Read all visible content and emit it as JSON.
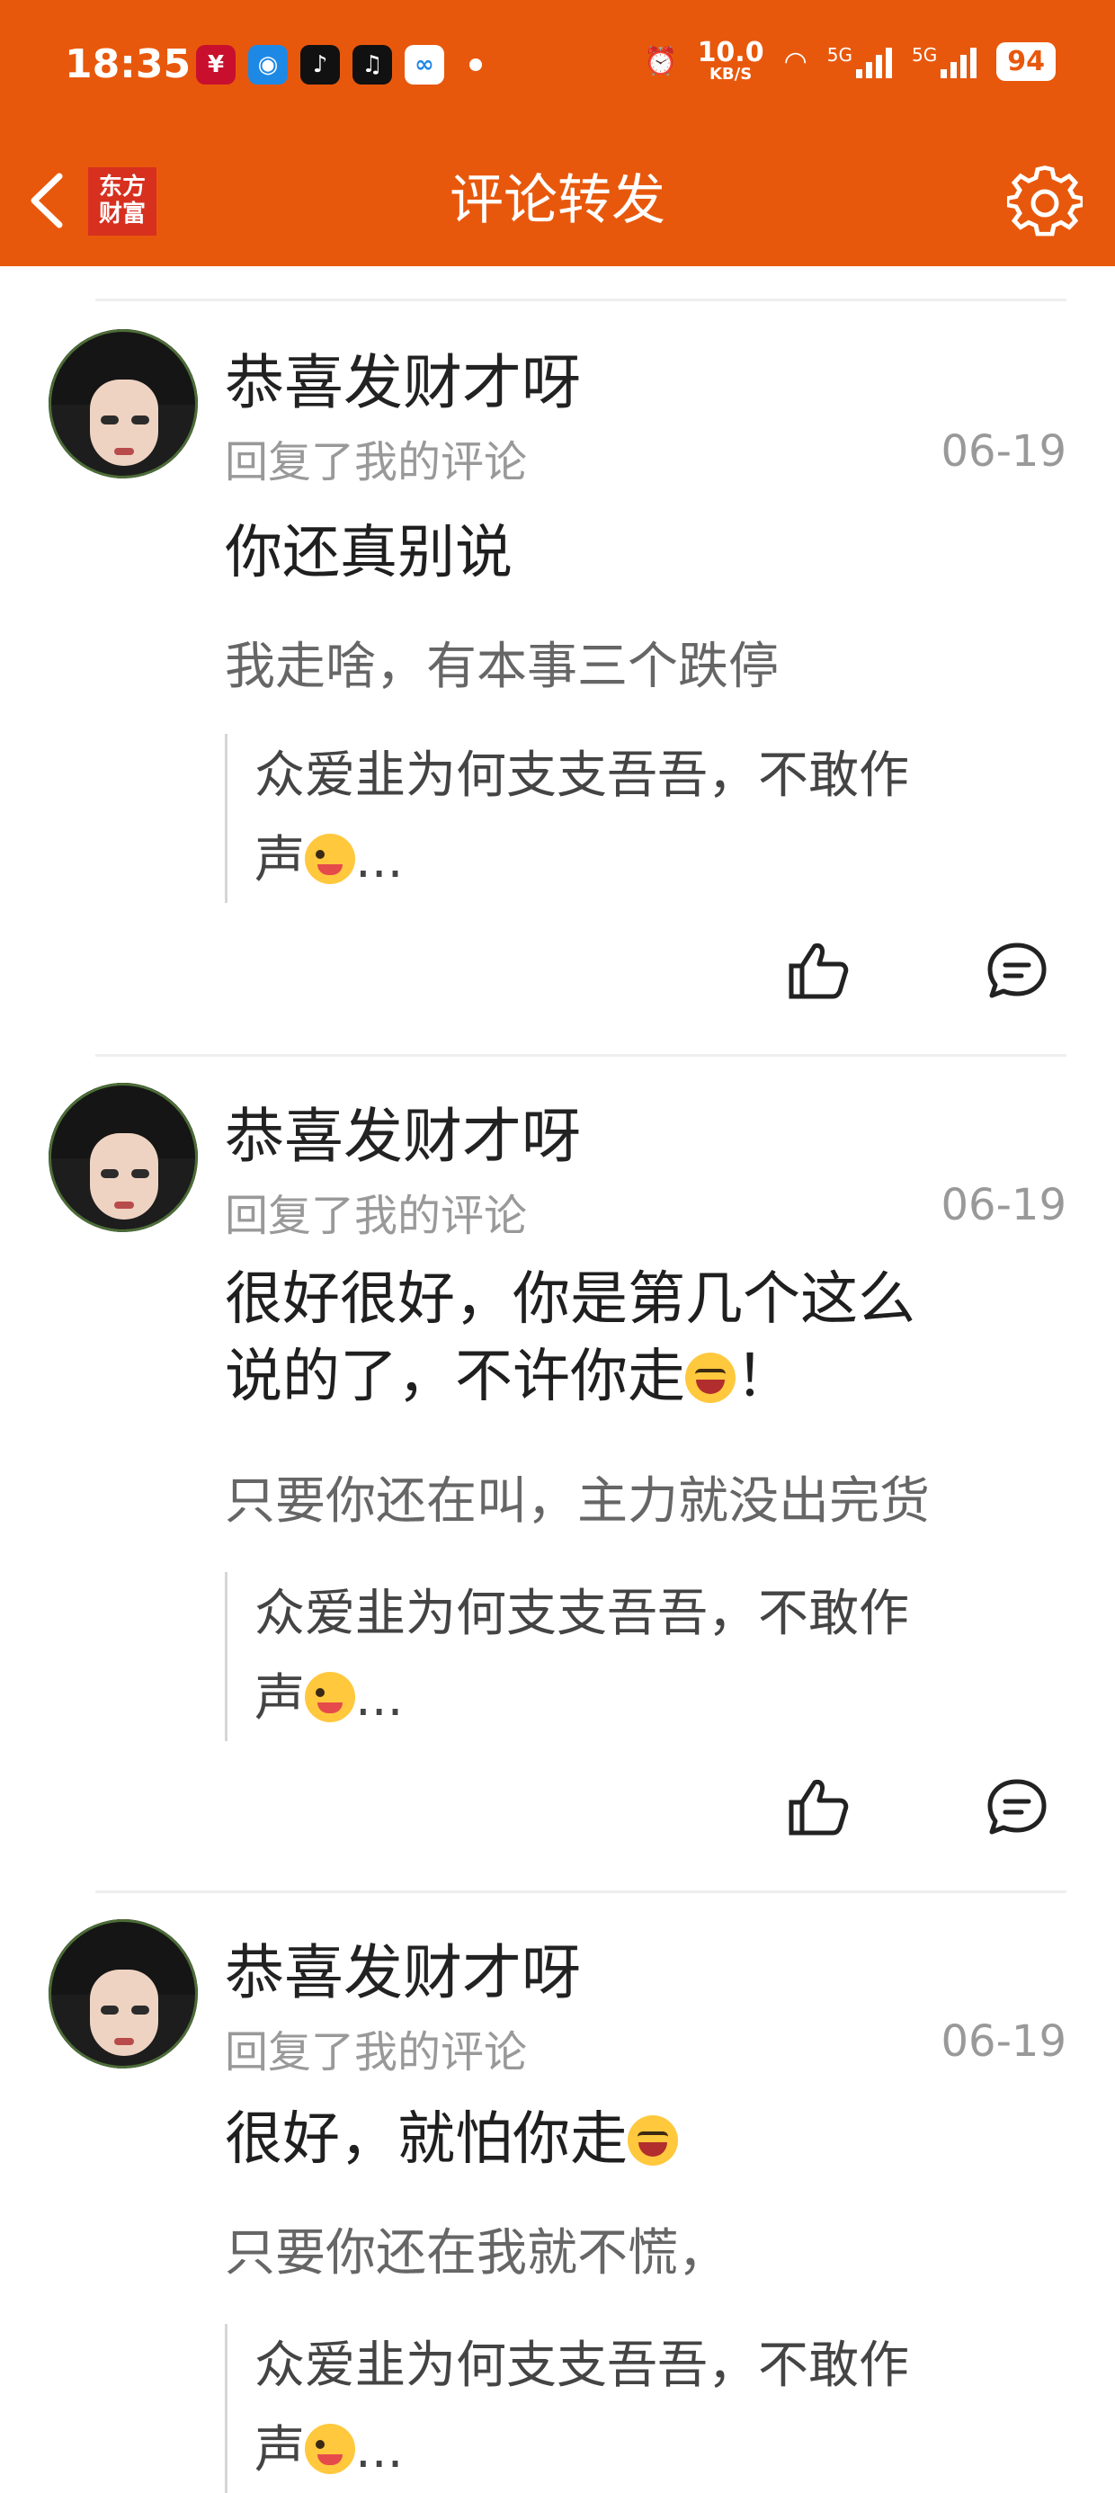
{
  "status": {
    "time": "18:35",
    "net_speed": "10.0",
    "net_unit": "KB/S",
    "network": "5G",
    "battery": "94"
  },
  "header": {
    "back": "back-icon",
    "logo_line1": "东方",
    "logo_line2": "财富",
    "title": "评论转发",
    "settings": "gear-icon"
  },
  "colors": {
    "brand": "#E8580C",
    "muted": "#999999"
  },
  "feed": {
    "items": [
      {
        "username": "恭喜发财才呀",
        "subtitle": "回复了我的评论",
        "date": "06-19",
        "reply": "你还真别说",
        "original": "我走啥，有本事三个跌停",
        "quote_line1": "众爱韭为何支支吾吾，不敢作",
        "quote_line2": "声",
        "quote_tail": "..."
      },
      {
        "username": "恭喜发财才呀",
        "subtitle": "回复了我的评论",
        "date": "06-19",
        "reply_line1": "很好很好，你是第几个这么",
        "reply_line2": "说的了，不许你走",
        "reply_tail": "！",
        "original": "只要你还在叫，主力就没出完货",
        "quote_line1": "众爱韭为何支支吾吾，不敢作",
        "quote_line2": "声",
        "quote_tail": "..."
      },
      {
        "username": "恭喜发财才呀",
        "subtitle": "回复了我的评论",
        "date": "06-19",
        "reply": "很好，就怕你走",
        "original": "只要你还在我就不慌，",
        "quote_line1": "众爱韭为何支支吾吾，不敢作",
        "quote_line2": "声",
        "quote_tail": "..."
      }
    ]
  }
}
